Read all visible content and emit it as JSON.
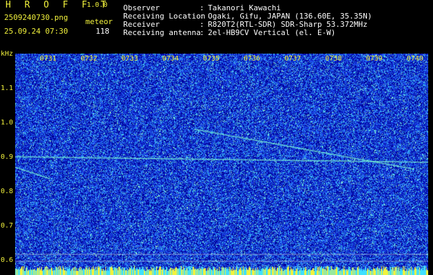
{
  "app": {
    "name": "H R O F F T",
    "version": "1.0.0"
  },
  "file": {
    "name": "2509240730.png",
    "datetime": "25.09.24 07:30"
  },
  "counter": {
    "label": "meteor",
    "value": "118"
  },
  "info": [
    {
      "key": "Observer",
      "value": "Takanori Kawachi"
    },
    {
      "key": "Receiving Location",
      "value": "Ogaki, Gifu, JAPAN (136.60E, 35.35N)"
    },
    {
      "key": "Receiver",
      "value": "R820T2(RTL-SDR) SDR-Sharp 53.372MHz"
    },
    {
      "key": "Receiving antenna",
      "value": "2el-HB9CV Vertical (el. E-W)"
    }
  ],
  "colon": ":",
  "axis": {
    "unit": "kHz",
    "time_ticks": [
      "0731",
      "0732",
      "0733",
      "0734",
      "0735",
      "0736",
      "0737",
      "0738",
      "0739",
      "0740"
    ],
    "freq_ticks": [
      "1.1",
      "1.0",
      "0.9",
      "0.8",
      "0.7",
      "0.6"
    ]
  },
  "colors": {
    "label": "#f2f23c",
    "bg": "#00008a",
    "noise": "#2a5cff",
    "trace": "#7fffd4"
  }
}
